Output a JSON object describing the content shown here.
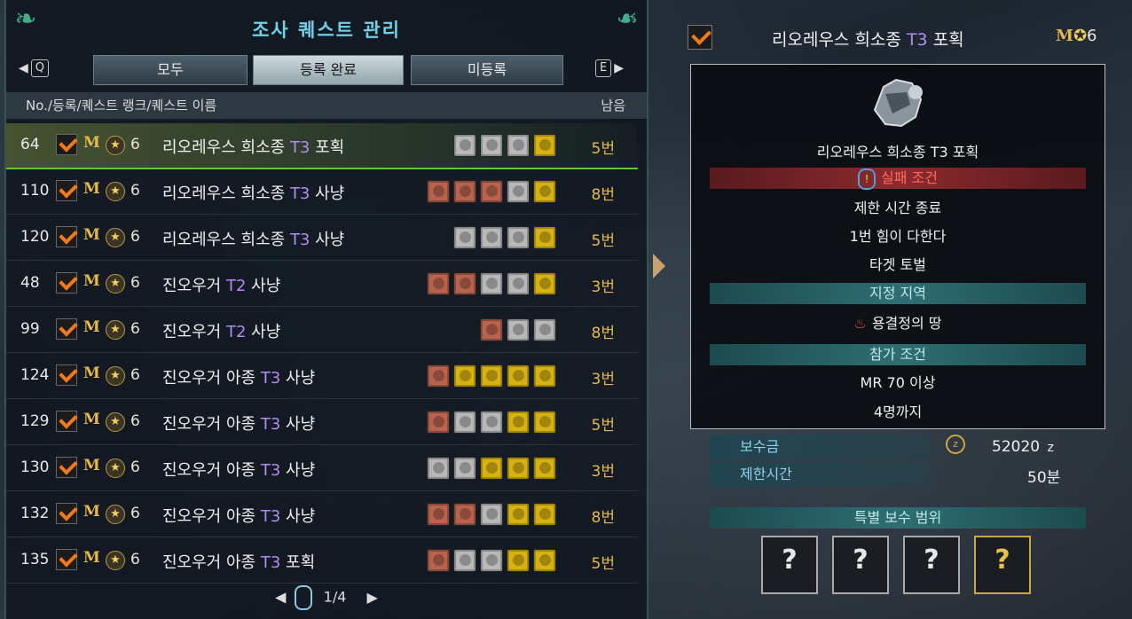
{
  "header": {
    "title": "조사 퀘스트 관리",
    "nav_left_key": "Q",
    "nav_right_key": "E",
    "tabs": [
      {
        "label": "모두",
        "active": false
      },
      {
        "label": "등록 완료",
        "active": true
      },
      {
        "label": "미등록",
        "active": false
      }
    ]
  },
  "columns": {
    "left": "No./등록/퀘스트 랭크/퀘스트 이름",
    "right": "남음"
  },
  "quests": [
    {
      "no": "64",
      "m": "M",
      "rank": "6",
      "name": "리오레우스 희소종",
      "tier": "T3",
      "type": "포획",
      "icons": [
        "g",
        "g",
        "g",
        "y"
      ],
      "count": "5번",
      "selected": true
    },
    {
      "no": "110",
      "m": "M",
      "rank": "6",
      "name": "리오레우스 희소종",
      "tier": "T3",
      "type": "사냥",
      "icons": [
        "r",
        "r",
        "r",
        "g",
        "y"
      ],
      "count": "8번",
      "selected": false
    },
    {
      "no": "120",
      "m": "M",
      "rank": "6",
      "name": "리오레우스 희소종",
      "tier": "T3",
      "type": "사냥",
      "icons": [
        "g",
        "g",
        "g",
        "y"
      ],
      "count": "5번",
      "selected": false
    },
    {
      "no": "48",
      "m": "M",
      "rank": "6",
      "name": "진오우거",
      "tier": "T2",
      "type": "사냥",
      "icons": [
        "r",
        "r",
        "g",
        "g",
        "y"
      ],
      "count": "3번",
      "selected": false
    },
    {
      "no": "99",
      "m": "M",
      "rank": "6",
      "name": "진오우거",
      "tier": "T2",
      "type": "사냥",
      "icons": [
        "r",
        "g",
        "g"
      ],
      "count": "8번",
      "selected": false
    },
    {
      "no": "124",
      "m": "M",
      "rank": "6",
      "name": "진오우거 아종",
      "tier": "T3",
      "type": "사냥",
      "icons": [
        "r",
        "y",
        "y",
        "y",
        "y"
      ],
      "count": "3번",
      "selected": false
    },
    {
      "no": "129",
      "m": "M",
      "rank": "6",
      "name": "진오우거 아종",
      "tier": "T3",
      "type": "사냥",
      "icons": [
        "r",
        "g",
        "g",
        "y",
        "y"
      ],
      "count": "5번",
      "selected": false
    },
    {
      "no": "130",
      "m": "M",
      "rank": "6",
      "name": "진오우거 아종",
      "tier": "T3",
      "type": "사냥",
      "icons": [
        "g",
        "g",
        "y",
        "y",
        "y"
      ],
      "count": "3번",
      "selected": false
    },
    {
      "no": "132",
      "m": "M",
      "rank": "6",
      "name": "진오우거 아종",
      "tier": "T3",
      "type": "사냥",
      "icons": [
        "r",
        "r",
        "g",
        "y",
        "y"
      ],
      "count": "8번",
      "selected": false
    },
    {
      "no": "135",
      "m": "M",
      "rank": "6",
      "name": "진오우거 아종",
      "tier": "T3",
      "type": "포획",
      "icons": [
        "r",
        "g",
        "g",
        "y",
        "y"
      ],
      "count": "5번",
      "selected": false
    }
  ],
  "pager": {
    "text": "1/4"
  },
  "detail": {
    "title_name": "리오레우스 희소종",
    "title_tier": "T3",
    "title_type": "포획",
    "rank_m": "M",
    "rank_num": "6",
    "monster_label": "리오레우스 희소종 T3 포획",
    "fail_header": "실패 조건",
    "fail_1": "제한 시간 종료",
    "fail_2": "1번 힘이 다한다",
    "fail_3": "타겟 토벌",
    "area_header": "지정 지역",
    "area": "용결정의 땅",
    "join_header": "참가 조건",
    "join_1": "MR 70 이상",
    "join_2": "4명까지",
    "reward_label": "보수금",
    "reward_value": "52020",
    "reward_unit": "z",
    "time_label": "제한시간",
    "time_value": "50분",
    "special_header": "특별 보수 범위",
    "reward_boxes": [
      {
        "symbol": "?",
        "gold": false
      },
      {
        "symbol": "?",
        "gold": false
      },
      {
        "symbol": "?",
        "gold": false
      },
      {
        "symbol": "?",
        "gold": true
      }
    ]
  },
  "colors": {
    "accent_title": "#6fd0e6",
    "tier": "#b28cf0",
    "count": "#e6b84a",
    "selected_border": "#5cc93a"
  }
}
